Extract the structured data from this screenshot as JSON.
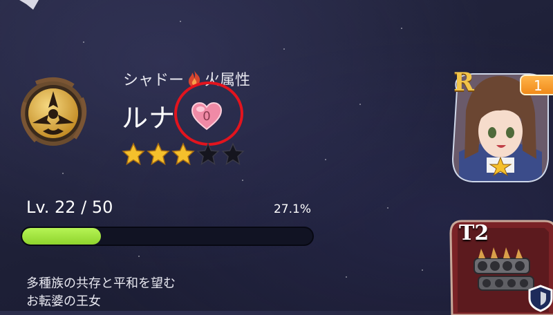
{
  "character": {
    "class_label": "シャドー",
    "element_label": "火属性",
    "name": "ルナ",
    "affection_count": "0",
    "stars_filled": 3,
    "stars_total": 5,
    "level_text": "Lv. 22 / 50",
    "exp_percent_text": "27.1%",
    "exp_fraction": 0.271,
    "description_lines": [
      "多種族の共存と平和を望む",
      "お転婆の王女"
    ]
  },
  "portrait": {
    "rarity": "R",
    "level_badge": "1"
  },
  "equipment": {
    "tier": "T2"
  },
  "icons": {
    "emblem": "shadow-emblem-icon",
    "element": "fire-icon",
    "affection": "heart-icon",
    "equipment": "knuckles-icon",
    "shield": "shield-icon"
  },
  "colors": {
    "highlight": "#e2141e",
    "xp_fill": "#a4e640",
    "star_gold": "#f5c02c",
    "rarity_gold": "#f2c54a"
  }
}
